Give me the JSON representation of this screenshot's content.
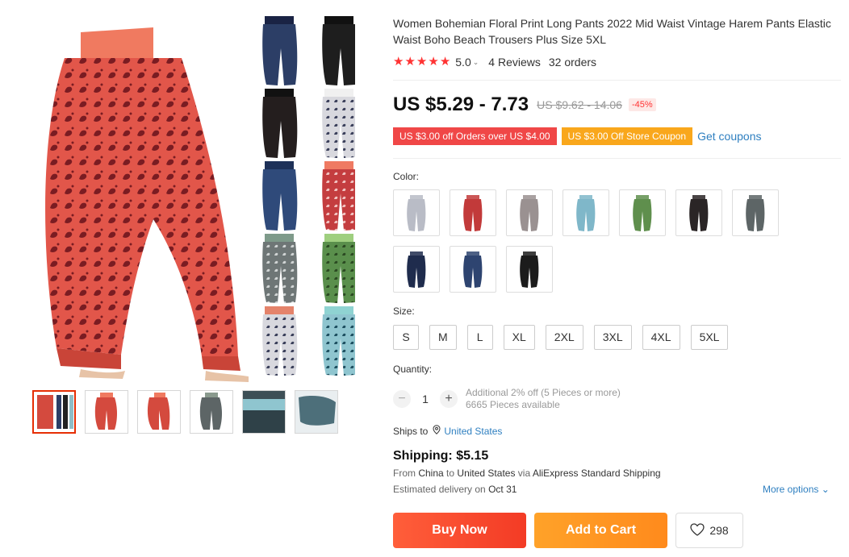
{
  "product": {
    "title": "Women Bohemian Floral Print Long Pants 2022 Mid Waist Vintage Harem Pants Elastic Waist Boho Beach Trousers Plus Size 5XL",
    "rating": "5.0",
    "stars": 5,
    "reviews": "4 Reviews",
    "orders": "32 orders",
    "price": "US $5.29 - 7.73",
    "original_price": "US $9.62 - 14.06",
    "discount": "-45%"
  },
  "coupons": {
    "coupon1": "US $3.00 off Orders over US $4.00",
    "coupon2": "US $3.00 Off Store Coupon",
    "get_coupons": "Get coupons"
  },
  "color": {
    "label": "Color:",
    "swatches": [
      {
        "name": "grey-paisley",
        "color": "#b9bcc6"
      },
      {
        "name": "red",
        "color": "#c23a3a"
      },
      {
        "name": "grey-brown",
        "color": "#9a9191"
      },
      {
        "name": "light-blue",
        "color": "#7fb7c9"
      },
      {
        "name": "green",
        "color": "#5f8f4d"
      },
      {
        "name": "black",
        "color": "#2a2526"
      },
      {
        "name": "dark-grey",
        "color": "#5d6566"
      },
      {
        "name": "navy",
        "color": "#1f2c4d"
      },
      {
        "name": "blue",
        "color": "#2e4470"
      },
      {
        "name": "solid-black",
        "color": "#1c1c1c"
      }
    ]
  },
  "size": {
    "label": "Size:",
    "options": [
      "S",
      "M",
      "L",
      "XL",
      "2XL",
      "3XL",
      "4XL",
      "5XL"
    ]
  },
  "quantity": {
    "label": "Quantity:",
    "value": "1",
    "note1": "Additional 2% off (5 Pieces or more)",
    "note2": "6665 Pieces available"
  },
  "shipping": {
    "ships_to_label": "Ships to",
    "country": "United States",
    "cost": "Shipping: $5.15",
    "from_prefix": "From",
    "from": "China",
    "to_prefix": "to",
    "to": "United States",
    "via_prefix": "via",
    "via": "AliExpress Standard Shipping",
    "delivery_prefix": "Estimated delivery on",
    "delivery_date": "Oct 31",
    "more_options": "More options"
  },
  "actions": {
    "buy_now": "Buy Now",
    "add_to_cart": "Add to Cart",
    "wishlist_count": "298"
  },
  "colors": {
    "accent_red": "#f33b25",
    "accent_orange": "#ff8a1c",
    "link_blue": "#2e7fc0",
    "star_red": "#ff3333"
  },
  "gallery": {
    "thumbnails": [
      "paisley-collage",
      "red-paisley-front",
      "red-paisley-side",
      "grey-paisley",
      "waistband-detail",
      "blue-paisley-detail"
    ],
    "active_index": 0
  }
}
